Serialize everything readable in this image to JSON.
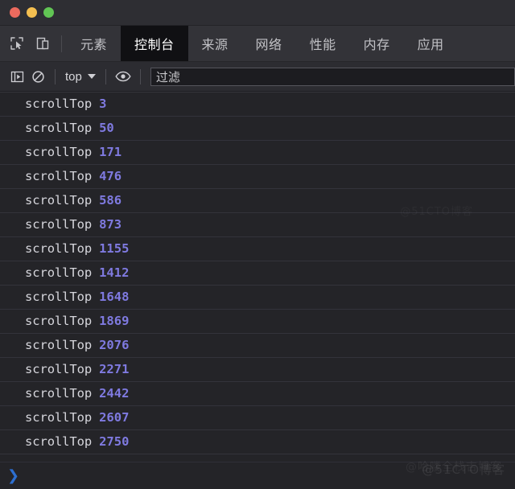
{
  "window": {
    "traffic_lights": [
      {
        "name": "close",
        "color": "#ec6a5e"
      },
      {
        "name": "minimize",
        "color": "#f4bf50"
      },
      {
        "name": "zoom",
        "color": "#61c554"
      }
    ]
  },
  "devtools": {
    "left_icons": [
      {
        "name": "inspect-element-icon",
        "glyph": "cursor-box"
      },
      {
        "name": "device-toolbar-icon",
        "glyph": "device"
      }
    ],
    "tabs": [
      {
        "id": "elements",
        "label": "元素",
        "active": false
      },
      {
        "id": "console",
        "label": "控制台",
        "active": true
      },
      {
        "id": "sources",
        "label": "来源",
        "active": false
      },
      {
        "id": "network",
        "label": "网络",
        "active": false
      },
      {
        "id": "performance",
        "label": "性能",
        "active": false
      },
      {
        "id": "memory",
        "label": "内存",
        "active": false
      },
      {
        "id": "application",
        "label": "应用",
        "active": false
      }
    ]
  },
  "console_toolbar": {
    "sidebar_toggle_icon": "console-sidebar-icon",
    "clear_icon": "clear-console-icon",
    "context_selector": {
      "label": "top",
      "caret": "▼"
    },
    "eye_icon": "live-expression-eye-icon",
    "filter": {
      "placeholder": "过滤",
      "value": ""
    }
  },
  "console_messages": [
    {
      "label": "scrollTop",
      "value": "3"
    },
    {
      "label": "scrollTop",
      "value": "50"
    },
    {
      "label": "scrollTop",
      "value": "171"
    },
    {
      "label": "scrollTop",
      "value": "476"
    },
    {
      "label": "scrollTop",
      "value": "586"
    },
    {
      "label": "scrollTop",
      "value": "873"
    },
    {
      "label": "scrollTop",
      "value": "1155"
    },
    {
      "label": "scrollTop",
      "value": "1412"
    },
    {
      "label": "scrollTop",
      "value": "1648"
    },
    {
      "label": "scrollTop",
      "value": "1869"
    },
    {
      "label": "scrollTop",
      "value": "2076"
    },
    {
      "label": "scrollTop",
      "value": "2271"
    },
    {
      "label": "scrollTop",
      "value": "2442"
    },
    {
      "label": "scrollTop",
      "value": "2607"
    },
    {
      "label": "scrollTop",
      "value": "2750"
    }
  ],
  "prompt": {
    "chevron": "❯",
    "input_value": ""
  },
  "watermarks": {
    "primary": "@51CTO博客",
    "secondary": "@哈喽全栈吉博客",
    "faint": "@51CTO博客"
  },
  "colors": {
    "background": "#242428",
    "titlebar": "#2e2e33",
    "tabbar": "#333338",
    "active_tab_bg": "#101013",
    "toolbar": "#2c2c31",
    "row_divider": "#33333b",
    "label_text": "#d6d6dc",
    "number_value": "#7f7ae0",
    "prompt_chevron": "#2d6fd1"
  }
}
